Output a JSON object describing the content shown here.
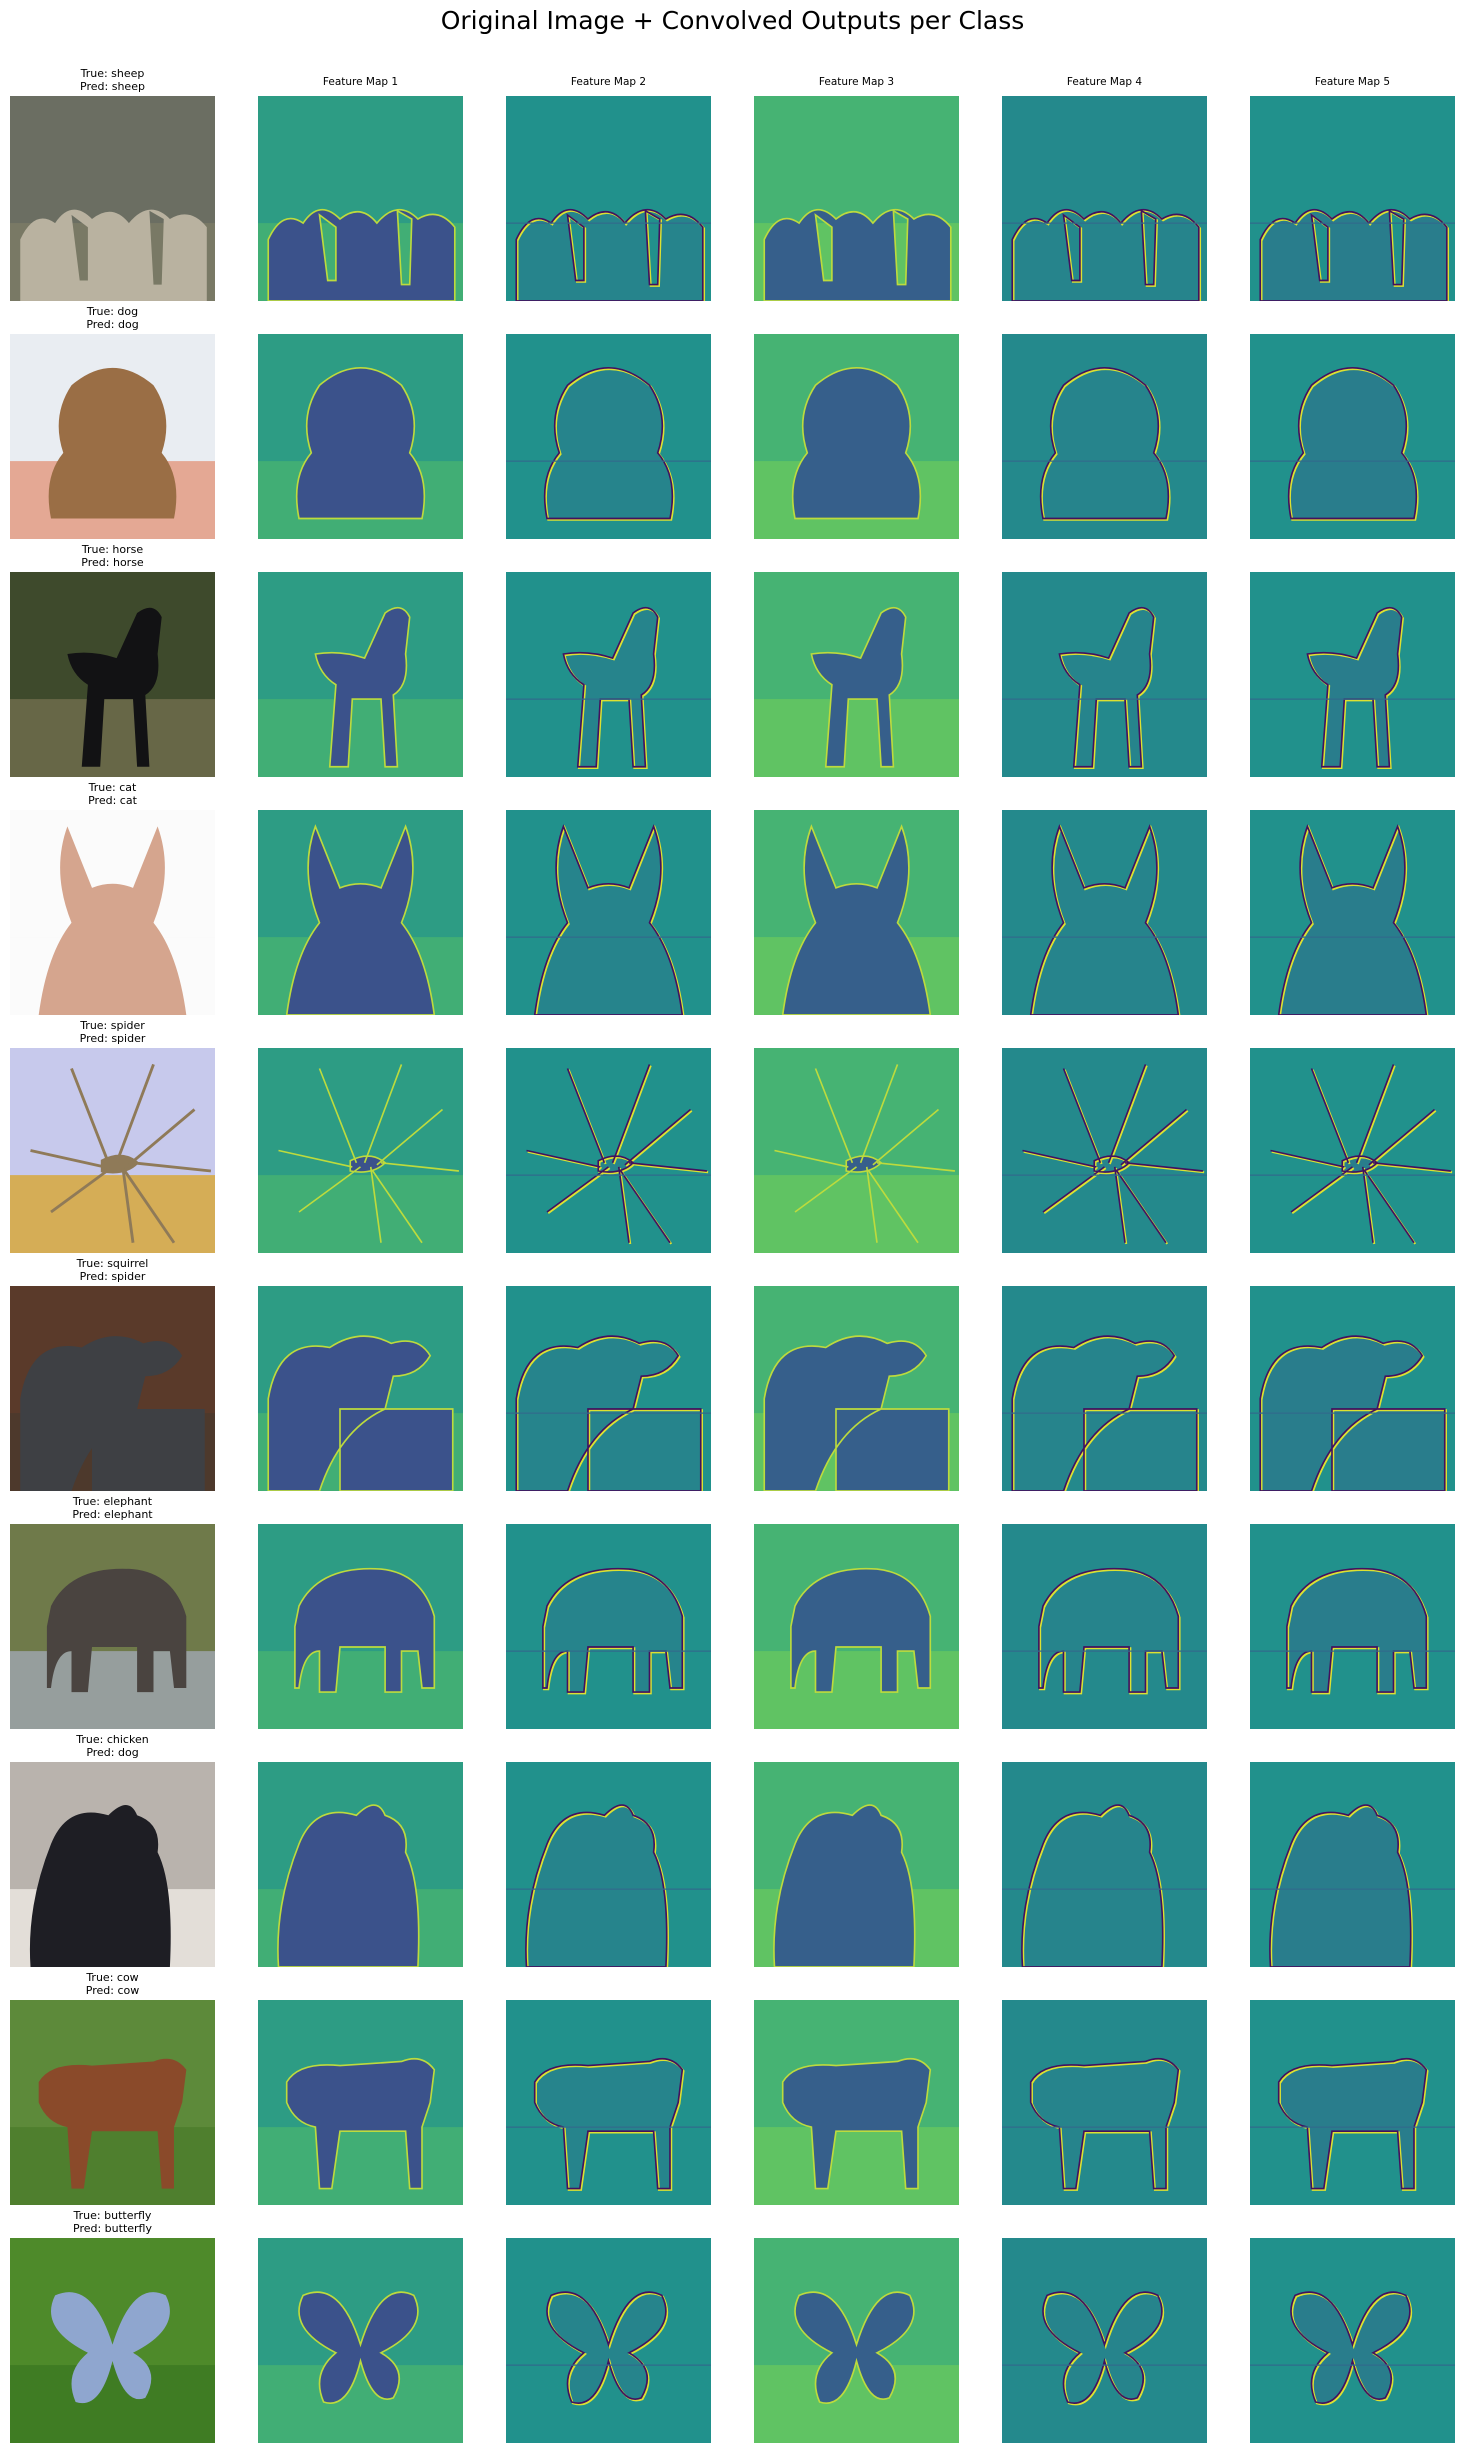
{
  "figure": {
    "title": "Original Image + Convolved Outputs per Class",
    "column_titles": [
      "Feature Map 1",
      "Feature Map 2",
      "Feature Map 3",
      "Feature Map 4",
      "Feature Map 5"
    ],
    "rows": [
      {
        "true_label": "True: sheep",
        "pred_label": "Pred: sheep",
        "subject": "sheep",
        "photo": {
          "bg": "#6b6e62",
          "ground": "#7b7a66",
          "body": "#b9b2a0",
          "shape": "flock"
        }
      },
      {
        "true_label": "True: dog",
        "pred_label": "Pred: dog",
        "subject": "dog",
        "photo": {
          "bg": "#e9edf2",
          "ground": "#e3a08a",
          "body": "#9a6e45",
          "shape": "puppy"
        }
      },
      {
        "true_label": "True: horse",
        "pred_label": "Pred: horse",
        "subject": "horse",
        "photo": {
          "bg": "#3e4a2c",
          "ground": "#6b6a4a",
          "body": "#121214",
          "shape": "horse"
        }
      },
      {
        "true_label": "True: cat",
        "pred_label": "Pred: cat",
        "subject": "cat",
        "photo": {
          "bg": "#fbfbfb",
          "ground": "#fbfbfb",
          "body": "#d5a58e",
          "shape": "cat"
        }
      },
      {
        "true_label": "True: spider",
        "pred_label": "Pred: spider",
        "subject": "spider",
        "photo": {
          "bg": "#c7c9ec",
          "ground": "#d6aa46",
          "body": "#8f7a58",
          "shape": "spider"
        }
      },
      {
        "true_label": "True: squirrel",
        "pred_label": "Pred: spider",
        "subject": "squirrel",
        "photo": {
          "bg": "#5a3a2a",
          "ground": "#4b3a2c",
          "body": "#3e4044",
          "shape": "squirrel"
        }
      },
      {
        "true_label": "True: elephant",
        "pred_label": "Pred: elephant",
        "subject": "elephant",
        "photo": {
          "bg": "#6f7a4a",
          "ground": "#9aa2a6",
          "body": "#4a4440",
          "shape": "elephant"
        }
      },
      {
        "true_label": "True: chicken",
        "pred_label": "Pred: dog",
        "subject": "chicken",
        "photo": {
          "bg": "#b9b3ad",
          "ground": "#e8e2dd",
          "body": "#1e1e24",
          "shape": "chicken"
        }
      },
      {
        "true_label": "True: cow",
        "pred_label": "Pred: cow",
        "subject": "cow",
        "photo": {
          "bg": "#5d8a3a",
          "ground": "#4e7d2e",
          "body": "#8a4a2a",
          "shape": "cow"
        }
      },
      {
        "true_label": "True: butterfly",
        "pred_label": "Pred: butterfly",
        "subject": "butterfly",
        "photo": {
          "bg": "#4e8a2a",
          "ground": "#3e7a22",
          "body": "#8fa6cf",
          "shape": "butterfly"
        }
      }
    ],
    "feature_colormap": [
      "#440154",
      "#3b528b",
      "#21918c",
      "#5ec962",
      "#fde725"
    ],
    "feature_map_styles": [
      {
        "kind": "intensity",
        "bg_level": 0.55,
        "subject_level": 0.25
      },
      {
        "kind": "edges",
        "bg_level": 0.5,
        "subject_level": 0.45
      },
      {
        "kind": "intensity",
        "bg_level": 0.65,
        "subject_level": 0.3
      },
      {
        "kind": "edges",
        "bg_level": 0.47,
        "subject_level": 0.45
      },
      {
        "kind": "edges",
        "bg_level": 0.5,
        "subject_level": 0.42
      }
    ]
  }
}
